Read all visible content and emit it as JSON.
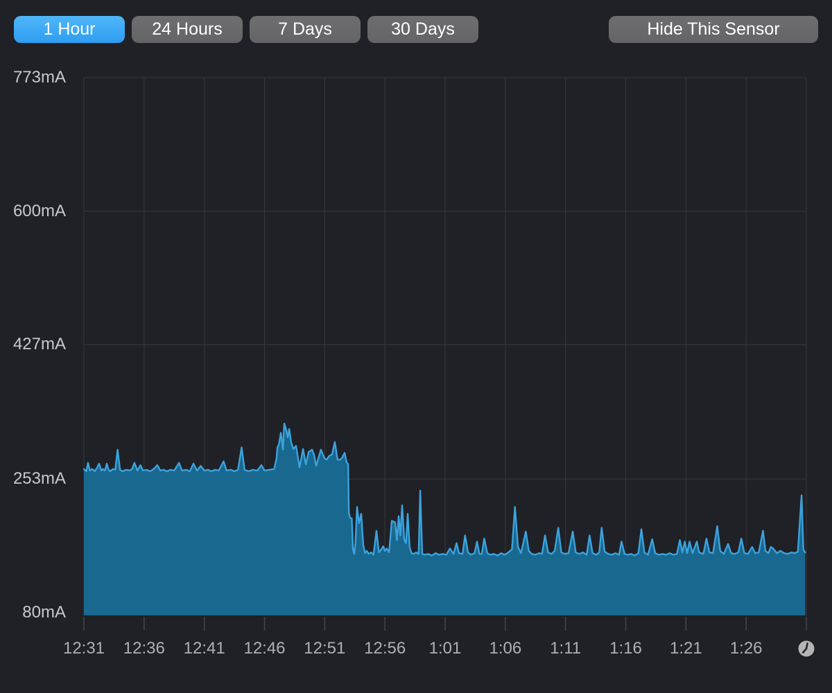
{
  "toolbar": {
    "ranges": [
      {
        "label": "1 Hour",
        "active": true
      },
      {
        "label": "24 Hours",
        "active": false
      },
      {
        "label": "7 Days",
        "active": false
      },
      {
        "label": "30 Days",
        "active": false
      }
    ],
    "hide_label": "Hide This Sensor"
  },
  "icons": {
    "clock": "clock-icon"
  },
  "colors": {
    "background": "#202126",
    "grid": "#37383b",
    "tick": "#44464a",
    "line": "#3ba3de",
    "fill": "#19688f",
    "active_button_top": "#4fb6f8",
    "active_button_bottom": "#2e9ef1",
    "inactive_button": "#69696b",
    "y_label": "#c8c9cb",
    "x_label": "#aeb0b3",
    "clock_icon": "#b5b5b5"
  },
  "chart_data": {
    "type": "area",
    "title": "",
    "unit": "mA",
    "xlabel": "",
    "ylabel": "",
    "ylim": [
      80,
      773
    ],
    "grid": true,
    "legend": false,
    "y_ticks": [
      {
        "value": 80,
        "label": "80mA"
      },
      {
        "value": 253,
        "label": "253mA"
      },
      {
        "value": 427,
        "label": "427mA"
      },
      {
        "value": 600,
        "label": "600mA"
      },
      {
        "value": 773,
        "label": "773mA"
      }
    ],
    "x_minutes_range": [
      0,
      60
    ],
    "x_ticks": [
      {
        "t": 0,
        "label": "12:31"
      },
      {
        "t": 5,
        "label": "12:36"
      },
      {
        "t": 10,
        "label": "12:41"
      },
      {
        "t": 15,
        "label": "12:46"
      },
      {
        "t": 20,
        "label": "12:51"
      },
      {
        "t": 25,
        "label": "12:56"
      },
      {
        "t": 30,
        "label": "1:01"
      },
      {
        "t": 35,
        "label": "1:06"
      },
      {
        "t": 40,
        "label": "1:11"
      },
      {
        "t": 45,
        "label": "1:16"
      },
      {
        "t": 50,
        "label": "1:21"
      },
      {
        "t": 55,
        "label": "1:26"
      }
    ],
    "series": [
      {
        "name": "sensor-current-mA",
        "points": [
          [
            0,
            266
          ],
          [
            0.2,
            263
          ],
          [
            0.34,
            274
          ],
          [
            0.5,
            264
          ],
          [
            0.7,
            266
          ],
          [
            0.9,
            263
          ],
          [
            1.1,
            268
          ],
          [
            1.26,
            273
          ],
          [
            1.45,
            264
          ],
          [
            1.6,
            266
          ],
          [
            1.75,
            264
          ],
          [
            1.9,
            273
          ],
          [
            2.05,
            265
          ],
          [
            2.2,
            263
          ],
          [
            2.4,
            266
          ],
          [
            2.6,
            265
          ],
          [
            2.8,
            291
          ],
          [
            3,
            265
          ],
          [
            3.2,
            263
          ],
          [
            3.5,
            265
          ],
          [
            3.8,
            264
          ],
          [
            4,
            266
          ],
          [
            4.2,
            274
          ],
          [
            4.45,
            264
          ],
          [
            4.7,
            271
          ],
          [
            4.9,
            264
          ],
          [
            5.2,
            265
          ],
          [
            5.5,
            263
          ],
          [
            5.8,
            266
          ],
          [
            6.1,
            271
          ],
          [
            6.35,
            264
          ],
          [
            6.6,
            265
          ],
          [
            6.9,
            263
          ],
          [
            7.2,
            265
          ],
          [
            7.5,
            264
          ],
          [
            7.9,
            274
          ],
          [
            8.15,
            264
          ],
          [
            8.5,
            265
          ],
          [
            8.8,
            263
          ],
          [
            9.1,
            273
          ],
          [
            9.4,
            264
          ],
          [
            9.7,
            270
          ],
          [
            10,
            264
          ],
          [
            10.3,
            265
          ],
          [
            10.6,
            263
          ],
          [
            10.9,
            265
          ],
          [
            11.2,
            264
          ],
          [
            11.6,
            276
          ],
          [
            11.85,
            264
          ],
          [
            12.2,
            265
          ],
          [
            12.5,
            263
          ],
          [
            12.8,
            265
          ],
          [
            13.1,
            294
          ],
          [
            13.35,
            265
          ],
          [
            13.7,
            263
          ],
          [
            14,
            265
          ],
          [
            14.4,
            264
          ],
          [
            14.74,
            271
          ],
          [
            15,
            264
          ],
          [
            15.4,
            265
          ],
          [
            15.8,
            266
          ],
          [
            16,
            280
          ],
          [
            16.07,
            294
          ],
          [
            16.2,
            298
          ],
          [
            16.36,
            313
          ],
          [
            16.53,
            291
          ],
          [
            16.64,
            325
          ],
          [
            16.82,
            316
          ],
          [
            16.93,
            307
          ],
          [
            17.05,
            318
          ],
          [
            17.22,
            300
          ],
          [
            17.39,
            292
          ],
          [
            17.62,
            296
          ],
          [
            17.91,
            268
          ],
          [
            18.2,
            292
          ],
          [
            18.43,
            272
          ],
          [
            18.66,
            288
          ],
          [
            18.95,
            291
          ],
          [
            19.12,
            284
          ],
          [
            19.29,
            270
          ],
          [
            19.69,
            291
          ],
          [
            19.98,
            280
          ],
          [
            20.15,
            278
          ],
          [
            20.38,
            283
          ],
          [
            20.61,
            285
          ],
          [
            20.84,
            301
          ],
          [
            21.07,
            278
          ],
          [
            21.25,
            278
          ],
          [
            21.42,
            280
          ],
          [
            21.65,
            287
          ],
          [
            21.82,
            275
          ],
          [
            21.95,
            272
          ],
          [
            22,
            210
          ],
          [
            22.1,
            203
          ],
          [
            22.25,
            202
          ],
          [
            22.35,
            162
          ],
          [
            22.45,
            156
          ],
          [
            22.55,
            170
          ],
          [
            22.69,
            217
          ],
          [
            22.85,
            196
          ],
          [
            23.03,
            208
          ],
          [
            23.2,
            168
          ],
          [
            23.35,
            157
          ],
          [
            23.5,
            160
          ],
          [
            23.65,
            156
          ],
          [
            23.85,
            158
          ],
          [
            24.05,
            155
          ],
          [
            24.3,
            186
          ],
          [
            24.5,
            158
          ],
          [
            24.7,
            162
          ],
          [
            24.85,
            166
          ],
          [
            25,
            160
          ],
          [
            25.15,
            163
          ],
          [
            25.35,
            158
          ],
          [
            25.57,
            199
          ],
          [
            25.85,
            197
          ],
          [
            26,
            174
          ],
          [
            26.14,
            205
          ],
          [
            26.28,
            180
          ],
          [
            26.43,
            219
          ],
          [
            26.6,
            175
          ],
          [
            26.75,
            170
          ],
          [
            26.89,
            208
          ],
          [
            27.05,
            165
          ],
          [
            27.2,
            157
          ],
          [
            27.4,
            156
          ],
          [
            27.6,
            158
          ],
          [
            27.8,
            156
          ],
          [
            27.93,
            238
          ],
          [
            28.1,
            156
          ],
          [
            28.3,
            155
          ],
          [
            28.6,
            156
          ],
          [
            28.9,
            154
          ],
          [
            29.2,
            157
          ],
          [
            29.5,
            155
          ],
          [
            29.8,
            156
          ],
          [
            30.1,
            155
          ],
          [
            30.4,
            163
          ],
          [
            30.7,
            156
          ],
          [
            30.95,
            170
          ],
          [
            31.15,
            157
          ],
          [
            31.45,
            156
          ],
          [
            31.65,
            180
          ],
          [
            31.9,
            158
          ],
          [
            32.15,
            155
          ],
          [
            32.45,
            157
          ],
          [
            32.65,
            172
          ],
          [
            32.85,
            156
          ],
          [
            33.05,
            156
          ],
          [
            33.25,
            176
          ],
          [
            33.5,
            157
          ],
          [
            33.75,
            155
          ],
          [
            34.05,
            156
          ],
          [
            34.35,
            154
          ],
          [
            34.65,
            157
          ],
          [
            34.95,
            155
          ],
          [
            35.25,
            158
          ],
          [
            35.55,
            162
          ],
          [
            35.8,
            217
          ],
          [
            36.05,
            165
          ],
          [
            36.3,
            157
          ],
          [
            36.7,
            185
          ],
          [
            36.95,
            160
          ],
          [
            37.2,
            156
          ],
          [
            37.5,
            155
          ],
          [
            37.8,
            157
          ],
          [
            38.05,
            156
          ],
          [
            38.3,
            180
          ],
          [
            38.55,
            158
          ],
          [
            38.85,
            156
          ],
          [
            39.1,
            160
          ],
          [
            39.4,
            190
          ],
          [
            39.65,
            158
          ],
          [
            39.95,
            156
          ],
          [
            40.25,
            157
          ],
          [
            40.6,
            185
          ],
          [
            40.85,
            158
          ],
          [
            41.15,
            156
          ],
          [
            41.45,
            158
          ],
          [
            41.75,
            155
          ],
          [
            42,
            180
          ],
          [
            42.25,
            157
          ],
          [
            42.55,
            155
          ],
          [
            42.8,
            158
          ],
          [
            43,
            190
          ],
          [
            43.25,
            159
          ],
          [
            43.55,
            156
          ],
          [
            43.85,
            155
          ],
          [
            44.15,
            157
          ],
          [
            44.45,
            155
          ],
          [
            44.65,
            172
          ],
          [
            44.9,
            156
          ],
          [
            45.15,
            155
          ],
          [
            45.45,
            156
          ],
          [
            45.75,
            154
          ],
          [
            46.05,
            157
          ],
          [
            46.3,
            188
          ],
          [
            46.55,
            158
          ],
          [
            46.85,
            155
          ],
          [
            47.2,
            175
          ],
          [
            47.45,
            157
          ],
          [
            47.75,
            155
          ],
          [
            48.05,
            156
          ],
          [
            48.35,
            155
          ],
          [
            48.65,
            157
          ],
          [
            48.95,
            155
          ],
          [
            49.25,
            156
          ],
          [
            49.5,
            174
          ],
          [
            49.7,
            158
          ],
          [
            49.9,
            172
          ],
          [
            50.1,
            157
          ],
          [
            50.3,
            172
          ],
          [
            50.55,
            157
          ],
          [
            50.9,
            172
          ],
          [
            51.1,
            158
          ],
          [
            51.45,
            156
          ],
          [
            51.7,
            176
          ],
          [
            51.95,
            158
          ],
          [
            52.25,
            157
          ],
          [
            52.6,
            192
          ],
          [
            52.85,
            160
          ],
          [
            53.15,
            156
          ],
          [
            53.5,
            169
          ],
          [
            53.75,
            157
          ],
          [
            54.05,
            156
          ],
          [
            54.35,
            158
          ],
          [
            54.6,
            176
          ],
          [
            54.85,
            157
          ],
          [
            55.15,
            156
          ],
          [
            55.5,
            165
          ],
          [
            55.75,
            157
          ],
          [
            56.05,
            158
          ],
          [
            56.4,
            186
          ],
          [
            56.6,
            160
          ],
          [
            56.85,
            157
          ],
          [
            57.05,
            165
          ],
          [
            57.25,
            163
          ],
          [
            57.55,
            157
          ],
          [
            57.85,
            160
          ],
          [
            58.15,
            157
          ],
          [
            58.45,
            156
          ],
          [
            58.75,
            158
          ],
          [
            59.05,
            157
          ],
          [
            59.3,
            159
          ],
          [
            59.6,
            232
          ],
          [
            59.75,
            162
          ],
          [
            59.9,
            158
          ]
        ]
      }
    ]
  }
}
